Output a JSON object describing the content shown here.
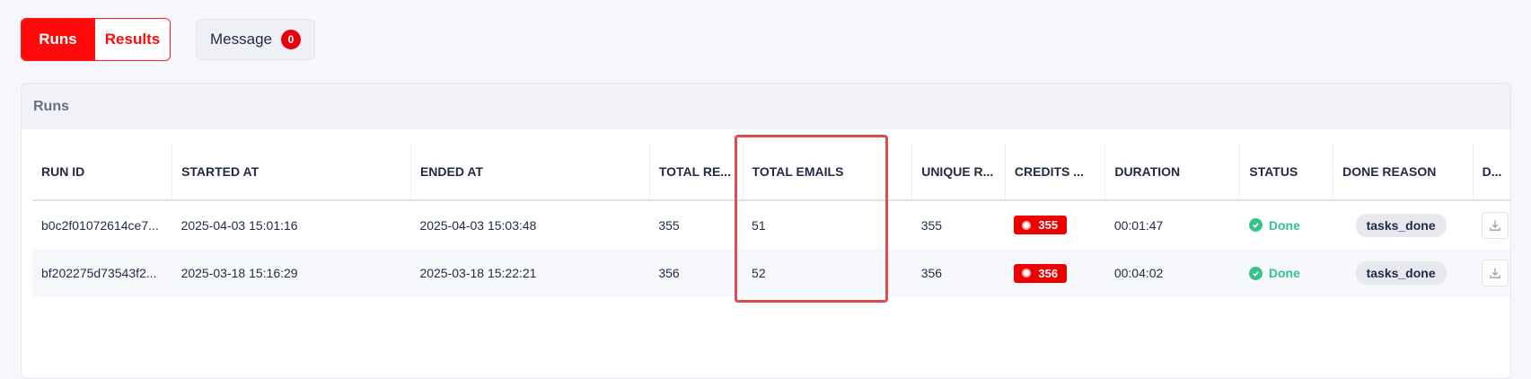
{
  "tabs": [
    {
      "label": "Runs",
      "active": true
    },
    {
      "label": "Results",
      "active": false
    }
  ],
  "message": {
    "label": "Message",
    "count": "0"
  },
  "panel": {
    "title": "Runs"
  },
  "columns": [
    "RUN ID",
    "STARTED AT",
    "ENDED AT",
    "TOTAL RE...",
    "TOTAL EMAILS",
    "UNIQUE R...",
    "CREDITS ...",
    "DURATION",
    "STATUS",
    "DONE REASON",
    "D..."
  ],
  "rows": [
    {
      "run_id": "b0c2f01072614ce7...",
      "started_at": "2025-04-03 15:01:16",
      "ended_at": "2025-04-03 15:03:48",
      "total_re": "355",
      "total_emails": "51",
      "unique_r": "355",
      "credits": "355",
      "duration": "00:01:47",
      "status": "Done",
      "done_reason": "tasks_done"
    },
    {
      "run_id": "bf202275d73543f2...",
      "started_at": "2025-03-18 15:16:29",
      "ended_at": "2025-03-18 15:22:21",
      "total_re": "356",
      "total_emails": "52",
      "unique_r": "356",
      "credits": "356",
      "duration": "00:04:02",
      "status": "Done",
      "done_reason": "tasks_done"
    }
  ],
  "colors": {
    "accent": "#ff0a0a",
    "status_done": "#34c48b",
    "highlight": "#e14b50"
  },
  "icons": {
    "status": "check-circle-icon",
    "download": "download-icon",
    "credits": "coin-icon"
  }
}
